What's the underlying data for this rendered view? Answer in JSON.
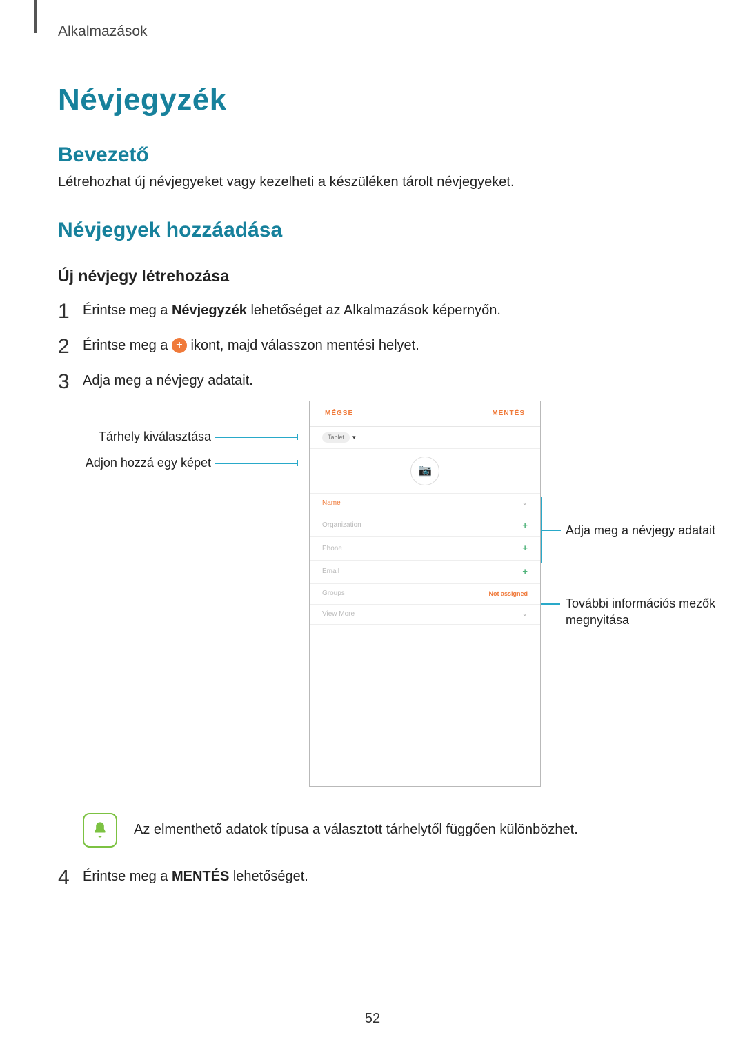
{
  "header": {
    "breadcrumb": "Alkalmazások"
  },
  "title": "Névjegyzék",
  "intro": {
    "heading": "Bevezető",
    "text": "Létrehozhat új névjegyeket vagy kezelheti a készüléken tárolt névjegyeket."
  },
  "adding": {
    "heading": "Névjegyek hozzáadása",
    "sub": "Új névjegy létrehozása",
    "steps": {
      "s1_a": "Érintse meg a ",
      "s1_bold": "Névjegyzék",
      "s1_b": " lehetőséget az Alkalmazások képernyőn.",
      "s2_a": "Érintse meg a ",
      "s2_b": " ikont, majd válasszon mentési helyet.",
      "s3": "Adja meg a névjegy adatait.",
      "s4_a": "Érintse meg a ",
      "s4_bold": "MENTÉS",
      "s4_b": " lehetőséget."
    }
  },
  "callouts": {
    "storage": "Tárhely kiválasztása",
    "photo": "Adjon hozzá egy képet",
    "details": "Adja meg a névjegy adatait",
    "more": "További információs mezők megnyitása"
  },
  "device": {
    "cancel": "MÉGSE",
    "save": "MENTÉS",
    "storage_label": "Tablet",
    "fields": {
      "name": "Name",
      "org": "Organization",
      "phone": "Phone",
      "email": "Email",
      "groups": "Groups",
      "groups_value": "Not assigned",
      "more": "View More"
    }
  },
  "note": "Az elmenthető adatok típusa a választott tárhelytől függően különbözhet.",
  "page_number": "52"
}
